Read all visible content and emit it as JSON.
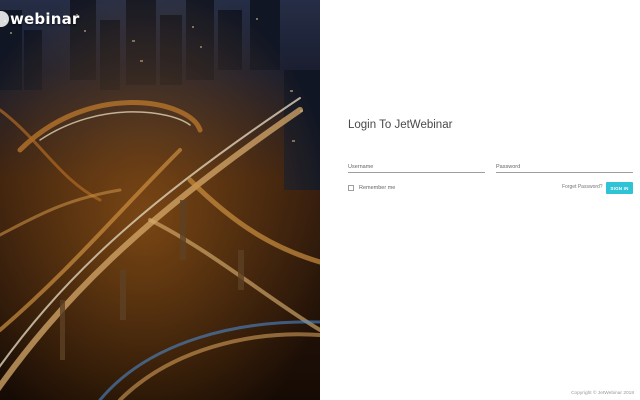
{
  "brand": {
    "name": "webinar",
    "logo_icon": "webinar-logo-mark"
  },
  "hero": {
    "image_icon": "city-night-highway-photo"
  },
  "login": {
    "title": "Login To JetWebinar",
    "username_placeholder": "Username",
    "password_placeholder": "Password",
    "remember_label": "Remember me",
    "forgot_label": "Forget Password?",
    "signin_label": "SIGN IN"
  },
  "footer": {
    "copyright": "Copyright © JetWebinar 2018"
  },
  "colors": {
    "accent": "#2fc3d6",
    "title_text": "#4a4a4a",
    "muted_text": "#666666"
  }
}
